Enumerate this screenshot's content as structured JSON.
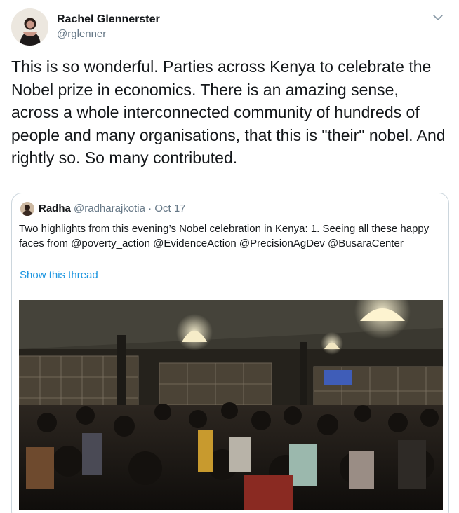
{
  "tweet": {
    "author_name": "Rachel Glennerster",
    "author_handle": "@rglenner",
    "text": "This is so wonderful. Parties across Kenya to celebrate the Nobel prize in economics. There is an amazing sense, across a whole interconnected community of hundreds of people and many organisations, that this is \"their\" nobel. And rightly so. So many contributed.",
    "menu_icon": "chevron-down-icon"
  },
  "quoted_tweet": {
    "author_name": "Radha",
    "author_handle": "@radharajkotia",
    "separator": "·",
    "date": "Oct 17",
    "text": "Two highlights from this evening’s Nobel celebration in Kenya: 1. Seeing all these happy faces from @poverty_action @EvidenceAction @PrecisionAgDev @BusaraCenter",
    "show_thread_label": "Show this thread"
  },
  "colors": {
    "text": "#14171a",
    "secondary": "#657786",
    "link": "#1b95e0",
    "border": "#ccd6dd"
  }
}
